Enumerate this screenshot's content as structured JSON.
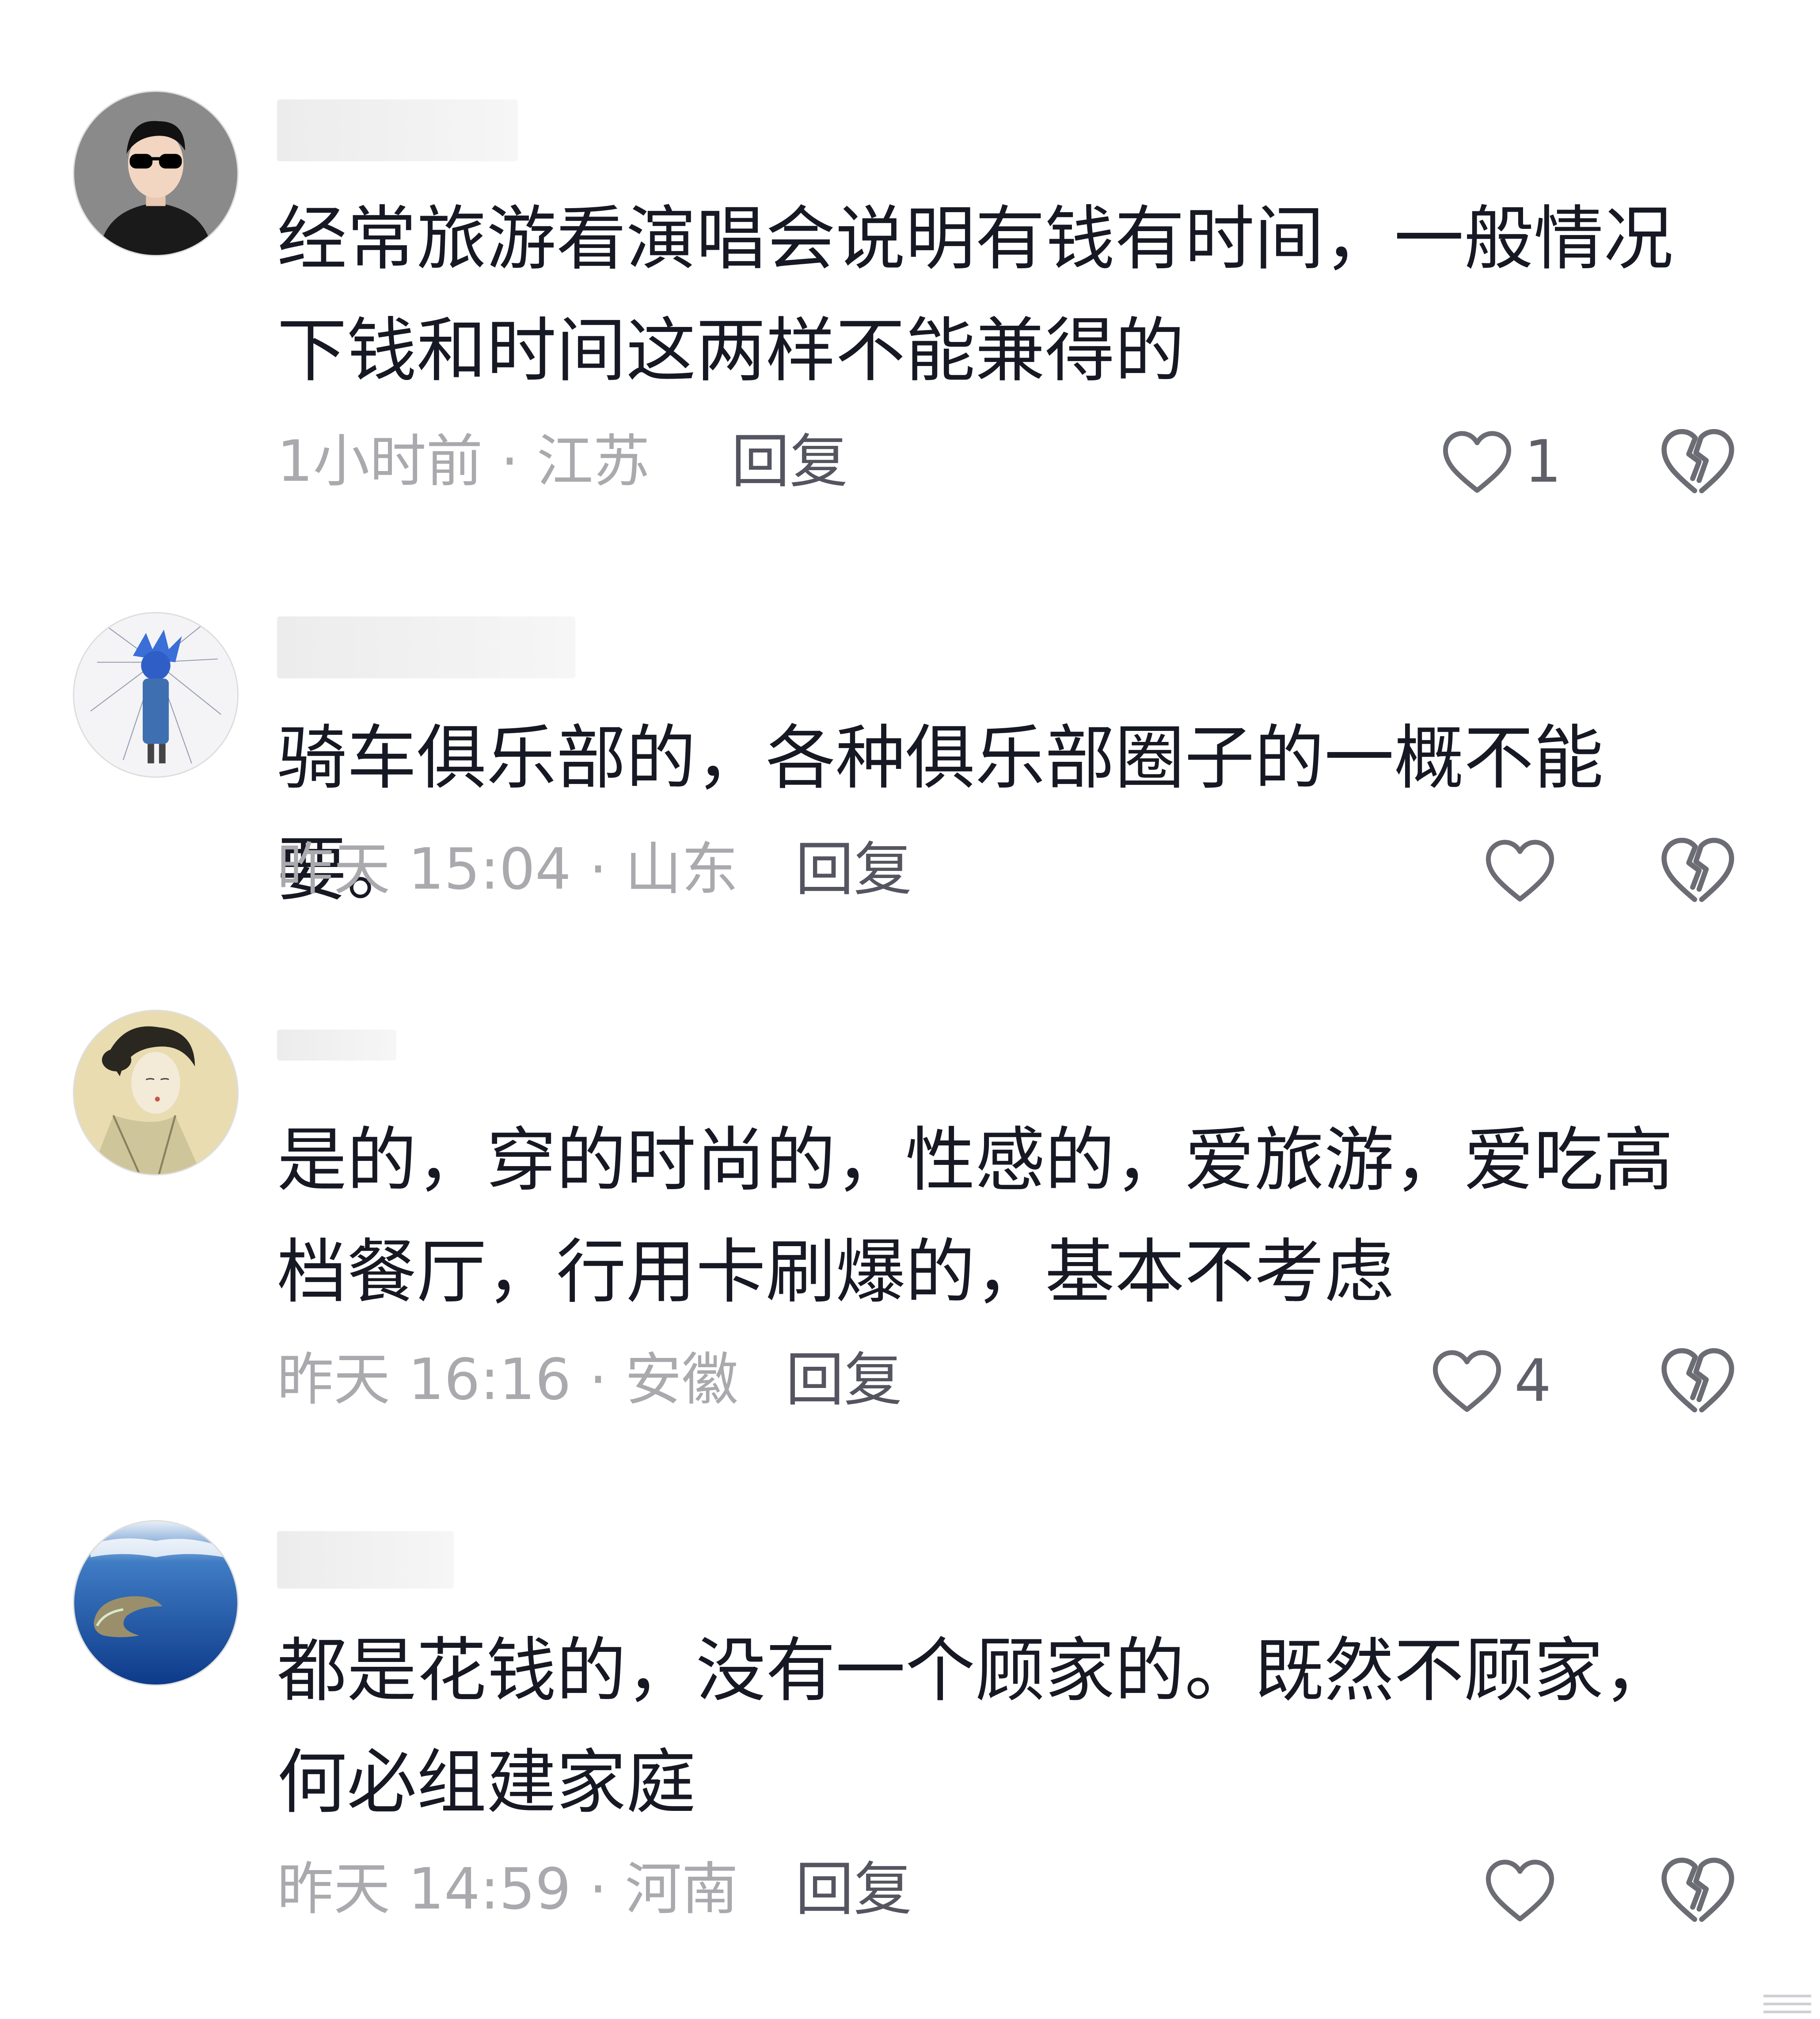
{
  "comments": [
    {
      "text": "经常旅游看演唱会说明有钱有时间，一般情况下钱和时间这两样不能兼得的",
      "time": "1小时前",
      "location": "江苏",
      "reply_label": "回复",
      "likes": "1",
      "avatar_icon": "man-with-sunglasses-avatar"
    },
    {
      "text": "骑车俱乐部的，各种俱乐部圈子的一概不能要。",
      "time": "昨天 15:04",
      "location": "山东",
      "reply_label": "回复",
      "likes": "",
      "avatar_icon": "abstract-blue-figure-avatar"
    },
    {
      "text": "是的，穿的时尚的，性感的，爱旅游，爱吃高档餐厅，行用卡刷爆的，基本不考虑",
      "time": "昨天 16:16",
      "location": "安徽",
      "reply_label": "回复",
      "likes": "4",
      "avatar_icon": "classical-lady-painting-avatar"
    },
    {
      "text": "都是花钱的，没有一个顾家的。既然不顾家，何必组建家庭",
      "time": "昨天 14:59",
      "location": "河南",
      "reply_label": "回复",
      "likes": "",
      "avatar_icon": "island-aerial-avatar"
    }
  ],
  "meta_separator": "·",
  "icons": {
    "like": "heart-outline-icon",
    "dislike": "broken-heart-icon"
  },
  "colors": {
    "text_primary": "#161823",
    "text_meta": "#a9a9ae",
    "reply": "#545560",
    "icon_stroke": "#6b6c74"
  }
}
